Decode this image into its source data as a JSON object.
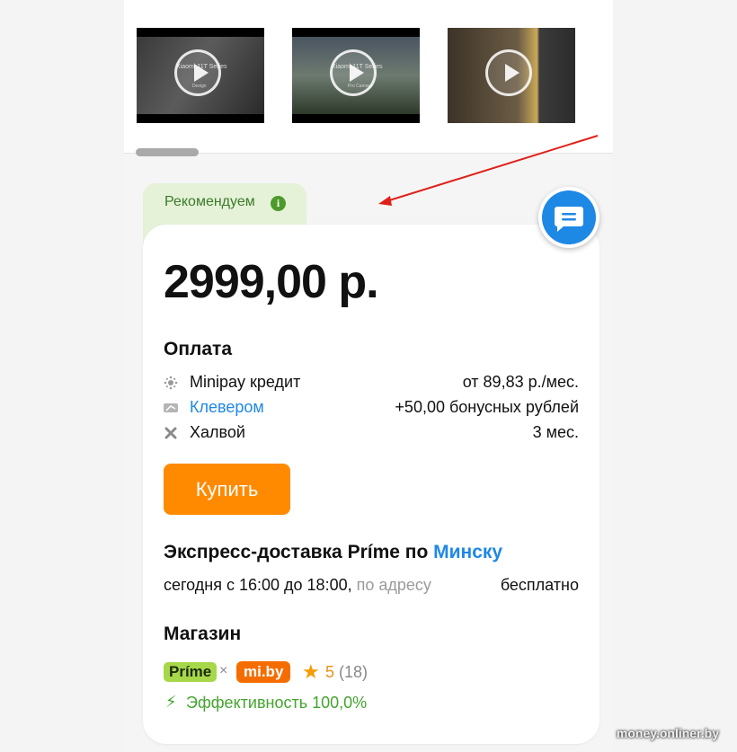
{
  "videos": [
    {
      "caption": "Xiaomi 11T Series",
      "subcaption": "Design"
    },
    {
      "caption": "Xiaomi 11T Series",
      "subcaption": "Pro Camera"
    },
    {
      "caption": "",
      "subcaption": ""
    }
  ],
  "recommend": {
    "label": "Рекомендуем",
    "info_icon_text": "i"
  },
  "price": "2999,00 р.",
  "payment": {
    "title": "Оплата",
    "options": [
      {
        "name": "Minipay кредит",
        "value": "от 89,83 р./мес.",
        "icon": "minipay-icon"
      },
      {
        "name": "Клевером",
        "value": "+50,00 бонусных рублей",
        "icon": "klever-card-icon"
      },
      {
        "name": "Халвой",
        "value": "3 мес.",
        "icon": "halva-icon"
      }
    ]
  },
  "buy_button": "Купить",
  "delivery": {
    "title_prefix": "Экспресс-доставка Príme по ",
    "title_city": "Минску",
    "time": "сегодня с 16:00 до 18:00,",
    "address": "по адресу",
    "cost": "бесплатно"
  },
  "shop": {
    "title": "Магазин",
    "prime_badge": "Príme",
    "times": "×",
    "shop_badge": "mi.by",
    "rating": "5",
    "reviews": "(18)",
    "efficiency": "Эффективность 100,0%"
  },
  "watermark": "money.onliner.by",
  "colors": {
    "accent": "#1e88e5",
    "buy": "#ff8a00",
    "green": "#43a52e",
    "recommend_bg": "#e5f2d8"
  }
}
